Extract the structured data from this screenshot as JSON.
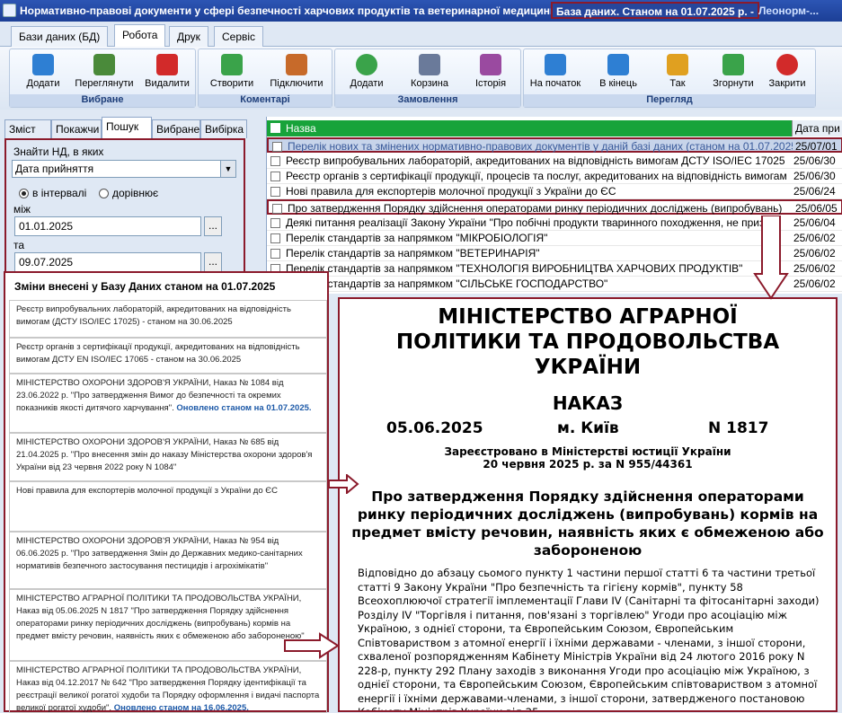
{
  "titlebar": {
    "title": "Нормативно-правові документи у сфері безпечності харчових продуктів та ветеринарної медицини",
    "db_status": "База даних. Станом на 01.07.2025 р. -",
    "user": "Леонорм-..."
  },
  "menu": {
    "tabs": [
      "Бази даних (БД)",
      "Робота",
      "Друк",
      "Сервіс"
    ]
  },
  "ribbon": {
    "groups": [
      {
        "label": "Вибране",
        "buttons": [
          "Додати",
          "Переглянути",
          "Видалити"
        ]
      },
      {
        "label": "Коментарі",
        "buttons": [
          "Створити",
          "Підключити"
        ]
      },
      {
        "label": "Замовлення",
        "buttons": [
          "Додати",
          "Корзина",
          "Історія"
        ]
      },
      {
        "label": "Перегляд",
        "buttons": [
          "На початок",
          "В кінець",
          "Так",
          "Згорнути",
          "Закрити"
        ]
      }
    ],
    "icon_colors": [
      "#2e7fd3",
      "#4a8a3a",
      "#d22a2a",
      "#3aa34a",
      "#c76a2a",
      "#3aa34a",
      "#6a7a9a",
      "#9a4aa0",
      "#2e7fd3",
      "#2e7fd3",
      "#e0a020",
      "#3aa34a",
      "#d22a2a"
    ]
  },
  "left": {
    "tabs": [
      "Зміст",
      "Покажчи",
      "Пошук",
      "Вибране",
      "Вибірка"
    ],
    "search_label": "Знайти НД, в яких",
    "search_field": "Дата прийняття",
    "radio_interval": "в інтервалі",
    "radio_equal": "дорівнює",
    "from_label": "між",
    "from_date": "01.01.2025",
    "to_label": "та",
    "to_date": "09.07.2025",
    "btn": "..."
  },
  "grid": {
    "col_name": "Назва",
    "col_date": "Дата при",
    "rows": [
      {
        "name": "Перелік нових та змінених нормативно-правових документів у даній базі даних (станом на 01.07.2025)",
        "date": "25/07/01"
      },
      {
        "name": "Реєстр випробувальних лабораторій, акредитованих на відповідність вимогам ДСТУ ISO/IEC 17025",
        "date": "25/06/30"
      },
      {
        "name": "Реєстр органів з сертифікації продукції, процесів та послуг, акредитованих на відповідність вимогам",
        "date": "25/06/30"
      },
      {
        "name": "Нові правила для експортерів молочної продукції з України до ЄС",
        "date": "25/06/24"
      },
      {
        "name": "Про затвердження Порядку здійснення операторами ринку періодичних досліджень (випробувань)",
        "date": "25/06/05"
      },
      {
        "name": "Деякі питання реалізації Закону України \"Про побічні продукти тваринного походження, не призна",
        "date": "25/06/04"
      },
      {
        "name": "Перелік стандартів за напрямком \"МІКРОБІОЛОГІЯ\"",
        "date": "25/06/02"
      },
      {
        "name": "Перелік стандартів за напрямком \"ВЕТЕРИНАРІЯ\"",
        "date": "25/06/02"
      },
      {
        "name": "Перелік стандартів за напрямком \"ТЕХНОЛОГІЯ ВИРОБНИЦТВА ХАРЧОВИХ ПРОДУКТІВ\"",
        "date": "25/06/02"
      },
      {
        "name": "Перелік стандартів за напрямком \"СІЛЬСЬКЕ ГОСПОДАРСТВО\"",
        "date": "25/06/02"
      }
    ]
  },
  "changes": {
    "header": "Зміни внесені у Базу Даних станом на 01.07.2025",
    "items": [
      {
        "text": "Реєстр випробувальних лабораторій, акредитованих на відповідність вимогам (ДСТУ ISO/IEC 17025)  - станом на 30.06.2025",
        "extra": ""
      },
      {
        "text": "Реєстр органів з сертифікації продукції, акредитованих на відповідність вимогам ДСТУ EN ISO/IEC 17065 - станом на 30.06.2025",
        "extra": ""
      },
      {
        "text": "МІНІСТЕРСТВО ОХОРОНИ ЗДОРОВ'Я  УКРАЇНИ, Наказ № 1084 від 23.06.2022 р. \"Про затвердження Вимог до безпечності та окремих показників якості дитячого харчування\".",
        "extra": "Оновлено станом на 01.07.2025."
      },
      {
        "text": "МІНІСТЕРСТВО ОХОРОНИ ЗДОРОВ'Я  УКРАЇНИ, Наказ № 685 від 21.04.2025 р. \"Про внесення змін до наказу Міністерства охорони здоров'я України від 23 червня 2022 року N 1084\"",
        "extra": ""
      },
      {
        "text": "Нові правила для експортерів молочної продукції з України до ЄС",
        "extra": ""
      },
      {
        "text": "МІНІСТЕРСТВО ОХОРОНИ ЗДОРОВ'Я  УКРАЇНИ, Наказ № 954 від 06.06.2025 р. \"Про затвердження Змін до Державних медико-санітарних нормативів безпечного застосування пестицидів і агрохімікатів\"",
        "extra": ""
      },
      {
        "text": "МІНІСТЕРСТВО АГРАРНОЇ ПОЛІТИКИ ТА ПРОДОВОЛЬСТВА УКРАЇНИ, Наказ від 05.06.2025 N 1817 \"Про затвердження Порядку здійснення операторами ринку періодичних досліджень (випробувань) кормів на предмет вмісту речовин, наявність яких є обмеженою або забороненою\"",
        "extra": ""
      },
      {
        "text": "МІНІСТЕРСТВО АГРАРНОЇ ПОЛІТИКИ ТА ПРОДОВОЛЬСТВА УКРАЇНИ, Наказ від 04.12.2017 № 642 \"Про затвердження Порядку ідентифікації та реєстрації великої рогатої худоби та Порядку оформлення і видачі паспорта великої рогатої худоби\".",
        "extra": "Оновлено станом на 16.06.2025."
      }
    ]
  },
  "doc": {
    "ministry": "МІНІСТЕРСТВО АГРАРНОЇ ПОЛІТИКИ ТА ПРОДОВОЛЬСТВА УКРАЇНИ",
    "type": "НАКАЗ",
    "date": "05.06.2025",
    "place": "м. Київ",
    "number": "N 1817",
    "registered": "Зареєстровано в Міністерстві юстиції України",
    "registered2": "20 червня 2025 р. за N 955/44361",
    "title": "Про затвердження Порядку здійснення операторами ринку періодичних досліджень (випробувань) кормів на предмет вмісту речовин, наявність яких є обмеженою або забороненою",
    "body": "Відповідно до абзацу сьомого пункту 1 частини першої статті 6 та частини третьої статті 9 Закону України \"Про безпечність та гігієну кормів\", пункту 58 Всеохоплюючої стратегії імплементації Глави IV (Санітарні та фітосанітарні заходи) Розділу IV \"Торгівля і питання, пов'язані з торгівлею\" Угоди про асоціацію між Україною, з однієї сторони, та Європейським Союзом, Європейським Співтовариством з атомної енергії і їхніми державами - членами, з іншої сторони, схваленої розпорядженням Кабінету Міністрів України від 24 лютого 2016 року N 228-р, пункту 292 Плану заходів з виконання Угоди про асоціацію між Україною, з однієї сторони, та Європейським Союзом, Європейським співтовариством з атомної енергії і їхніми державами-членами, з іншої сторони, затвердженого постановою Кабінету Міністрів України від 25"
  }
}
